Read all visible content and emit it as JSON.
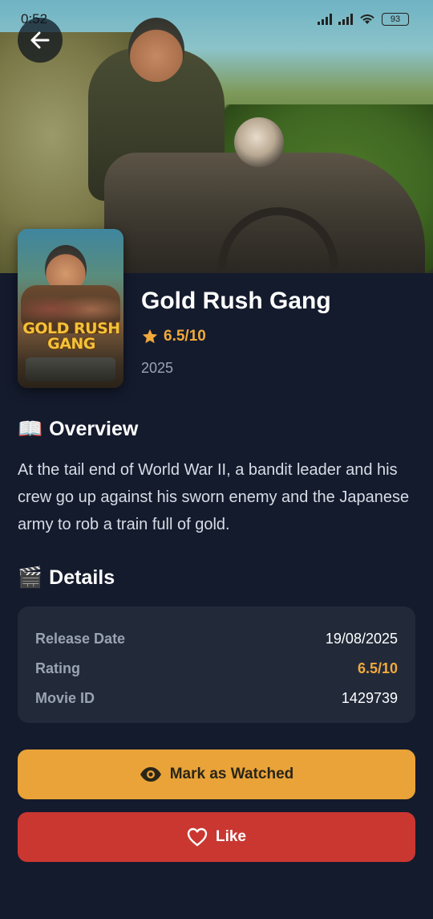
{
  "status_bar": {
    "time": "0:52",
    "battery": "93"
  },
  "movie": {
    "title": "Gold Rush Gang",
    "rating": "6.5/10",
    "year": "2025",
    "poster_title": "GOLD RUSH GANG"
  },
  "overview": {
    "emoji": "📖",
    "heading": "Overview",
    "text": "At the tail end of World War II, a bandit leader and his crew go up against his sworn enemy and the Japanese army to rob a train full of gold."
  },
  "details": {
    "emoji": "🎬",
    "heading": "Details",
    "rows": [
      {
        "label": "Release Date",
        "value": "19/08/2025"
      },
      {
        "label": "Rating",
        "value": "6.5/10"
      },
      {
        "label": "Movie ID",
        "value": "1429739"
      }
    ]
  },
  "actions": {
    "watched_label": "Mark as Watched",
    "like_label": "Like"
  },
  "colors": {
    "background": "#141b2d",
    "card": "#222a3a",
    "accent": "#f1a93b",
    "watched_button": "#eaa338",
    "like_button": "#ca3731"
  },
  "icons": {
    "back": "arrow-left-icon",
    "star": "star-icon",
    "watched": "eye-icon",
    "like": "heart-outline-icon"
  }
}
